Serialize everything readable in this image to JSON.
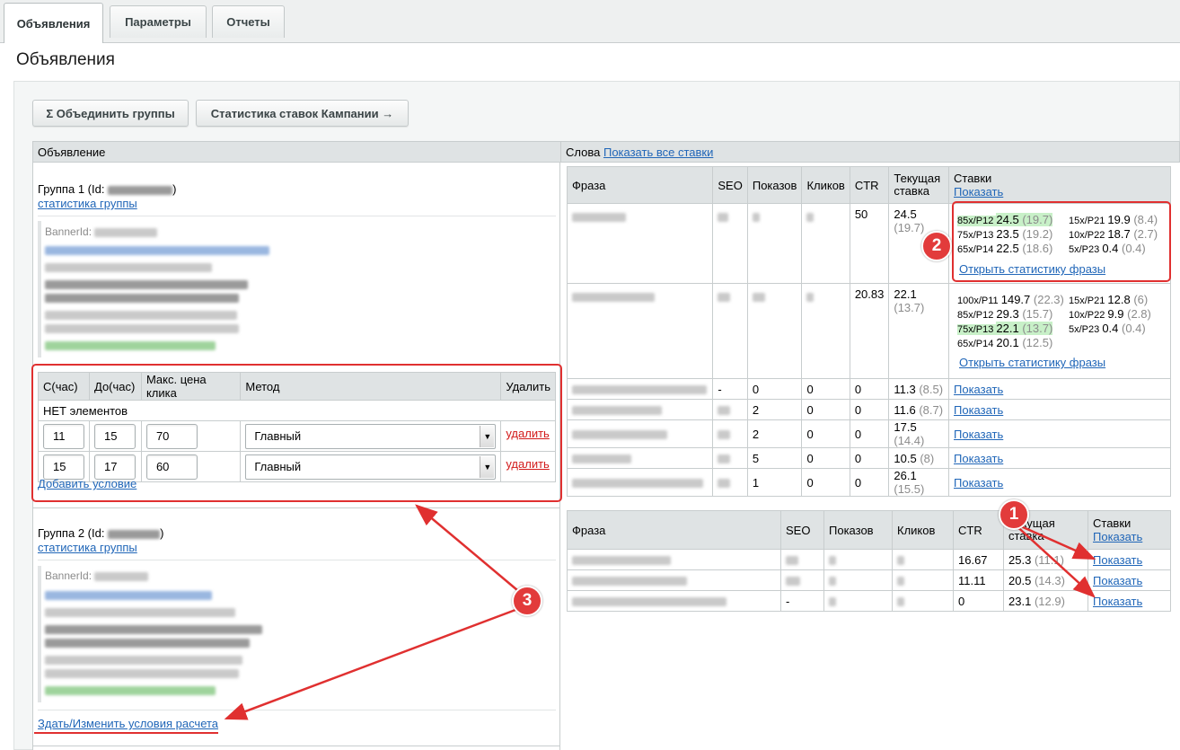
{
  "tabs": [
    "Объявления",
    "Параметры",
    "Отчеты"
  ],
  "page_title": "Объявления",
  "toolbar": {
    "merge": "Σ Объединить группы",
    "stats": "Статистика ставок Кампании →"
  },
  "left_header": "Объявление",
  "right_header": {
    "label": "Слова",
    "link": "Показать все ставки"
  },
  "group1": {
    "title": "Группа 1 (Id: ",
    "title_end": ")",
    "stats_link": "статистика группы",
    "banner_label": "BannerId:"
  },
  "conditions": {
    "headers": [
      "С(час)",
      "До(час)",
      "Макс. цена клика",
      "Метод",
      "Удалить"
    ],
    "empty": "НЕТ элементов",
    "rows": [
      {
        "from": "11",
        "to": "15",
        "max": "70",
        "method": "Главный",
        "del": "удалить"
      },
      {
        "from": "15",
        "to": "17",
        "max": "60",
        "method": "Главный",
        "del": "удалить"
      }
    ],
    "add": "Добавить условие"
  },
  "group2": {
    "title": "Группа 2 (Id: ",
    "title_end": ")",
    "stats_link": "статистика группы",
    "banner_label": "BannerId:",
    "edit_link": "Здать/Изменить условия расчета"
  },
  "words1": {
    "headers": [
      "Фраза",
      "SEO",
      "Показов",
      "Кликов",
      "CTR",
      "Текущая ставка",
      "Ставки"
    ],
    "show": "Показать",
    "rows": [
      {
        "ctr": "50",
        "bid": "24.5",
        "bid2": "(19.7)"
      },
      {
        "ctr": "20.83",
        "bid": "22.1",
        "bid2": "(13.7)"
      },
      {
        "seo": "-",
        "views": "0",
        "clicks": "0",
        "ctr": "0",
        "bid": "11.3",
        "bid2": "(8.5)"
      },
      {
        "views": "2",
        "clicks": "0",
        "ctr": "0",
        "bid": "11.6",
        "bid2": "(8.7)"
      },
      {
        "views": "2",
        "clicks": "0",
        "ctr": "0",
        "bid": "17.5",
        "bid2": "(14.4)"
      },
      {
        "views": "5",
        "clicks": "0",
        "ctr": "0",
        "bid": "10.5",
        "bid2": "(8)"
      },
      {
        "views": "1",
        "clicks": "0",
        "ctr": "0",
        "bid": "26.1",
        "bid2": "(15.5)"
      }
    ],
    "bids1": [
      [
        "85x/P12",
        "24.5",
        "(19.7)",
        "15x/P21",
        "19.9",
        "(8.4)"
      ],
      [
        "75x/P13",
        "23.5",
        "(19.2)",
        "10x/P22",
        "18.7",
        "(2.7)"
      ],
      [
        "65x/P14",
        "22.5",
        "(18.6)",
        "5x/P23",
        "0.4",
        "(0.4)"
      ]
    ],
    "bids2": [
      [
        "100x/P11",
        "149.7",
        "(22.3)",
        "15x/P21",
        "12.8",
        "(6)"
      ],
      [
        "85x/P12",
        "29.3",
        "(15.7)",
        "10x/P22",
        "9.9",
        "(2.8)"
      ],
      [
        "75x/P13",
        "22.1",
        "(13.7)",
        "5x/P23",
        "0.4",
        "(0.4)"
      ],
      [
        "65x/P14",
        "20.1",
        "(12.5)",
        "",
        "",
        ""
      ]
    ],
    "open_stats": "Открыть статистику фразы"
  },
  "words2": {
    "headers": [
      "Фраза",
      "SEO",
      "Показов",
      "Кликов",
      "CTR",
      "Текущая ставка",
      "Ставки"
    ],
    "show": "Показать",
    "rows": [
      {
        "ctr": "16.67",
        "bid": "25.3",
        "bid2": "(11.1)"
      },
      {
        "ctr": "11.11",
        "bid": "20.5",
        "bid2": "(14.3)"
      },
      {
        "seo": "-",
        "ctr": "0",
        "bid": "23.1",
        "bid2": "(12.9)"
      }
    ]
  },
  "badges": [
    "1",
    "2",
    "3"
  ],
  "colors": {
    "annotation": "#e03030",
    "link": "#2066b8",
    "highlight": "#c8f0c8"
  }
}
